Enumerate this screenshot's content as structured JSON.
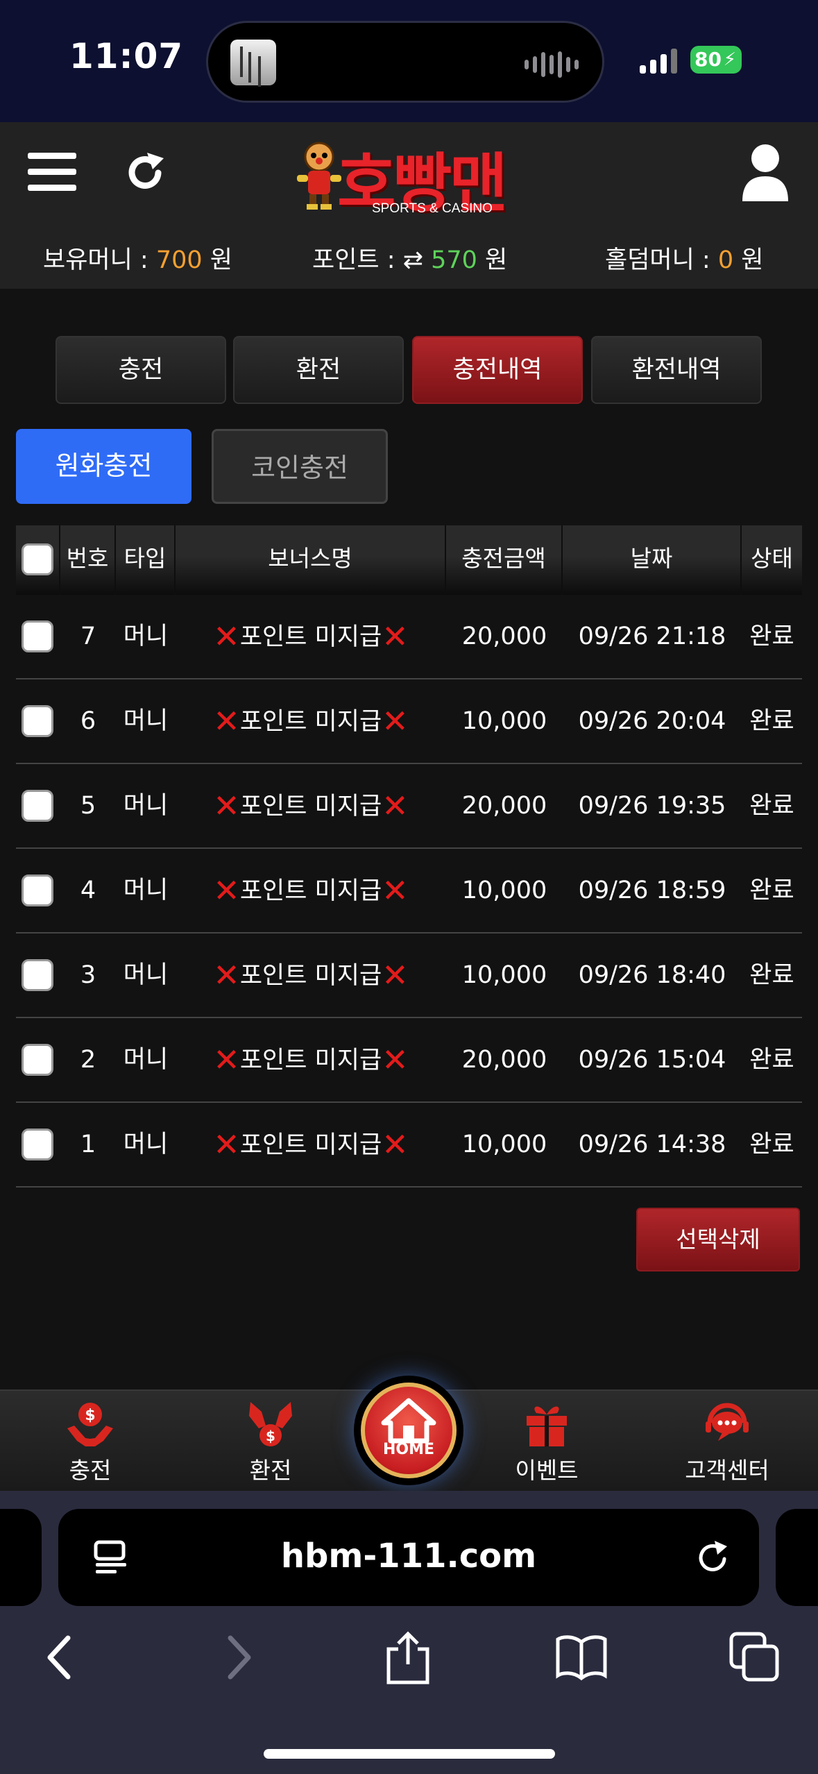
{
  "status": {
    "time": "11:07",
    "battery": "80"
  },
  "header": {
    "logo_text": "호빵맨",
    "logo_sub": "SPORTS & CASINO",
    "balance": {
      "label": "보유머니 : ",
      "value": "700",
      "unit": " 원"
    },
    "points": {
      "label": "포인트 : ",
      "value": "570",
      "unit": " 원"
    },
    "holdem": {
      "label": "홀덤머니 : ",
      "value": "0",
      "unit": " 원"
    }
  },
  "tabs": [
    "충전",
    "환전",
    "충전내역",
    "환전내역"
  ],
  "active_tab": "충전내역",
  "subtabs": {
    "fiat": "원화충전",
    "coin": "코인충전"
  },
  "table": {
    "headers": {
      "no": "번호",
      "type": "타입",
      "bonus": "보너스명",
      "amount": "충전금액",
      "date": "날짜",
      "status": "상태"
    },
    "rows": [
      {
        "no": "7",
        "type": "머니",
        "bonus": "포인트 미지급",
        "amount": "20,000",
        "date": "09/26 21:18",
        "status": "완료"
      },
      {
        "no": "6",
        "type": "머니",
        "bonus": "포인트 미지급",
        "amount": "10,000",
        "date": "09/26 20:04",
        "status": "완료"
      },
      {
        "no": "5",
        "type": "머니",
        "bonus": "포인트 미지급",
        "amount": "20,000",
        "date": "09/26 19:35",
        "status": "완료"
      },
      {
        "no": "4",
        "type": "머니",
        "bonus": "포인트 미지급",
        "amount": "10,000",
        "date": "09/26 18:59",
        "status": "완료"
      },
      {
        "no": "3",
        "type": "머니",
        "bonus": "포인트 미지급",
        "amount": "10,000",
        "date": "09/26 18:40",
        "status": "완료"
      },
      {
        "no": "2",
        "type": "머니",
        "bonus": "포인트 미지급",
        "amount": "20,000",
        "date": "09/26 15:04",
        "status": "완료"
      },
      {
        "no": "1",
        "type": "머니",
        "bonus": "포인트 미지급",
        "amount": "10,000",
        "date": "09/26 14:38",
        "status": "완료"
      }
    ]
  },
  "delete_button": "선택삭제",
  "bottom_nav": {
    "deposit": "충전",
    "withdraw": "환전",
    "home": "HOME",
    "event": "이벤트",
    "support": "고객센터"
  },
  "browser": {
    "url": "hbm-111.com"
  },
  "colors": {
    "accent_red": "#b0262a",
    "accent_blue": "#2f6cf6",
    "money_orange": "#f5a031",
    "point_green": "#5ed25a"
  }
}
